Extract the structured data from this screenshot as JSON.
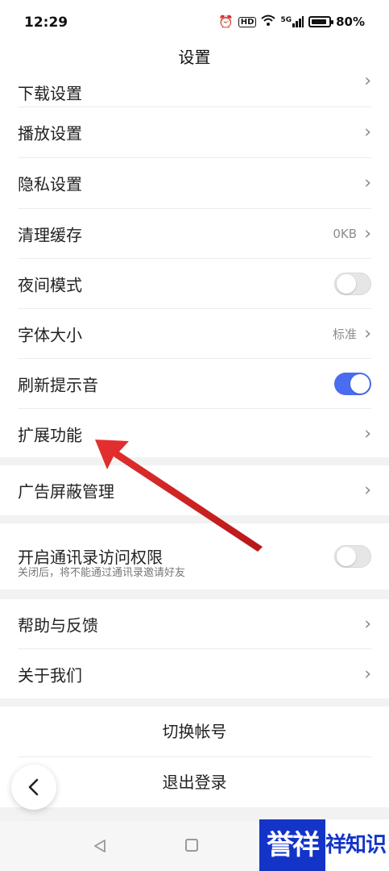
{
  "status_bar": {
    "time": "12:29",
    "hd": "HD",
    "signal": "5G",
    "battery": "80%",
    "battery_level": 0.8
  },
  "header": {
    "title": "设置"
  },
  "settings": {
    "download": "下载设置",
    "playback": "播放设置",
    "privacy": "隐私设置",
    "clear_cache": {
      "label": "清理缓存",
      "value": "0KB"
    },
    "night_mode": {
      "label": "夜间模式",
      "enabled": false
    },
    "font_size": {
      "label": "字体大小",
      "value": "标准"
    },
    "refresh_sound": {
      "label": "刷新提示音",
      "enabled": true
    },
    "extensions": "扩展功能",
    "ad_block": "广告屏蔽管理",
    "contacts": {
      "label": "开启通讯录访问权限",
      "subtext": "关闭后，将不能通过通讯录邀请好友",
      "enabled": false
    },
    "help": "帮助与反馈",
    "about": "关于我们"
  },
  "account": {
    "switch": "切换帐号",
    "logout": "退出登录"
  },
  "chevron": "›",
  "watermark": {
    "brand": "誉祥",
    "text": "祥知识"
  },
  "colors": {
    "accent": "#4a6cf0",
    "arrow": "#e02020",
    "watermark": "#1434c8"
  }
}
